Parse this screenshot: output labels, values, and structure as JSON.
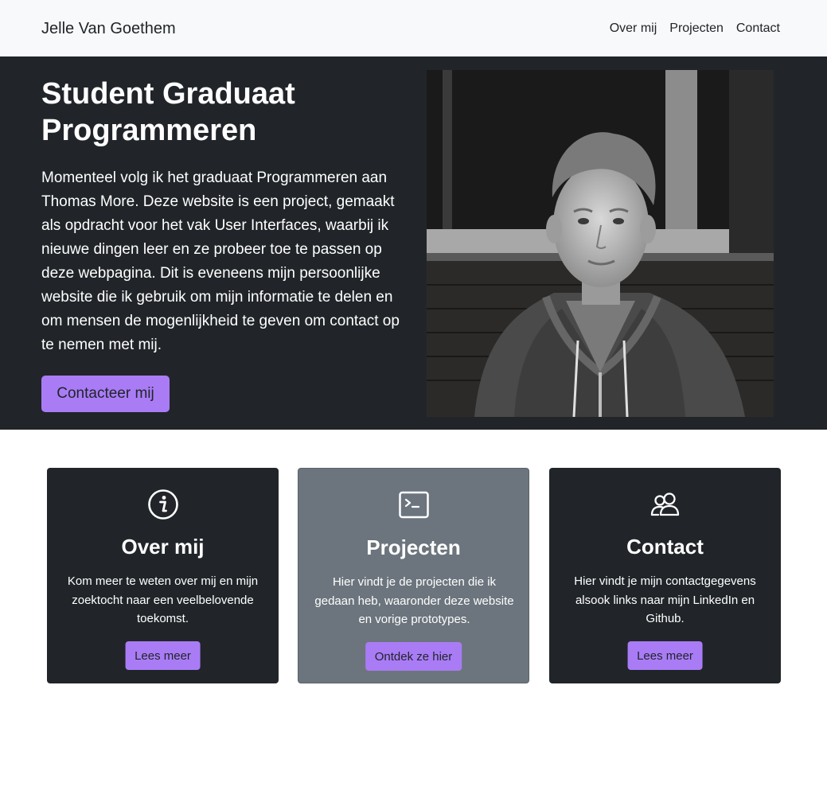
{
  "navbar": {
    "brand": "Jelle Van Goethem",
    "links": [
      "Over mij",
      "Projecten",
      "Contact"
    ]
  },
  "hero": {
    "title": "Student Graduaat Programmeren",
    "text": "Momenteel volg ik het graduaat Programmeren aan Thomas More. Deze website is een project, gemaakt als opdracht voor het vak User Interfaces, waarbij ik nieuwe dingen leer en ze probeer toe te passen op deze webpagina. Dit is eveneens mijn persoonlijke website die ik gebruik om mijn informatie te delen en om mensen de mogenlijkheid te geven om contact op te nemen met mij.",
    "button": "Contacteer mij",
    "image_alt": "portrait-photo"
  },
  "cards": [
    {
      "icon": "info-circle-icon",
      "title": "Over mij",
      "text": "Kom meer te weten over mij en mijn zoektocht naar een veelbelovende toekomst.",
      "button": "Lees meer"
    },
    {
      "icon": "terminal-icon",
      "title": "Projecten",
      "text": "Hier vindt je de projecten die ik gedaan heb, waaronder deze website en vorige prototypes.",
      "button": "Ontdek ze hier"
    },
    {
      "icon": "people-icon",
      "title": "Contact",
      "text": "Hier vindt je mijn contactgegevens alsook links naar mijn LinkedIn en Github.",
      "button": "Lees meer"
    }
  ],
  "colors": {
    "navbar_bg": "#f8f9fa",
    "dark_bg": "#212529",
    "grey_card": "#6c757d",
    "accent": "#a97cf6"
  }
}
